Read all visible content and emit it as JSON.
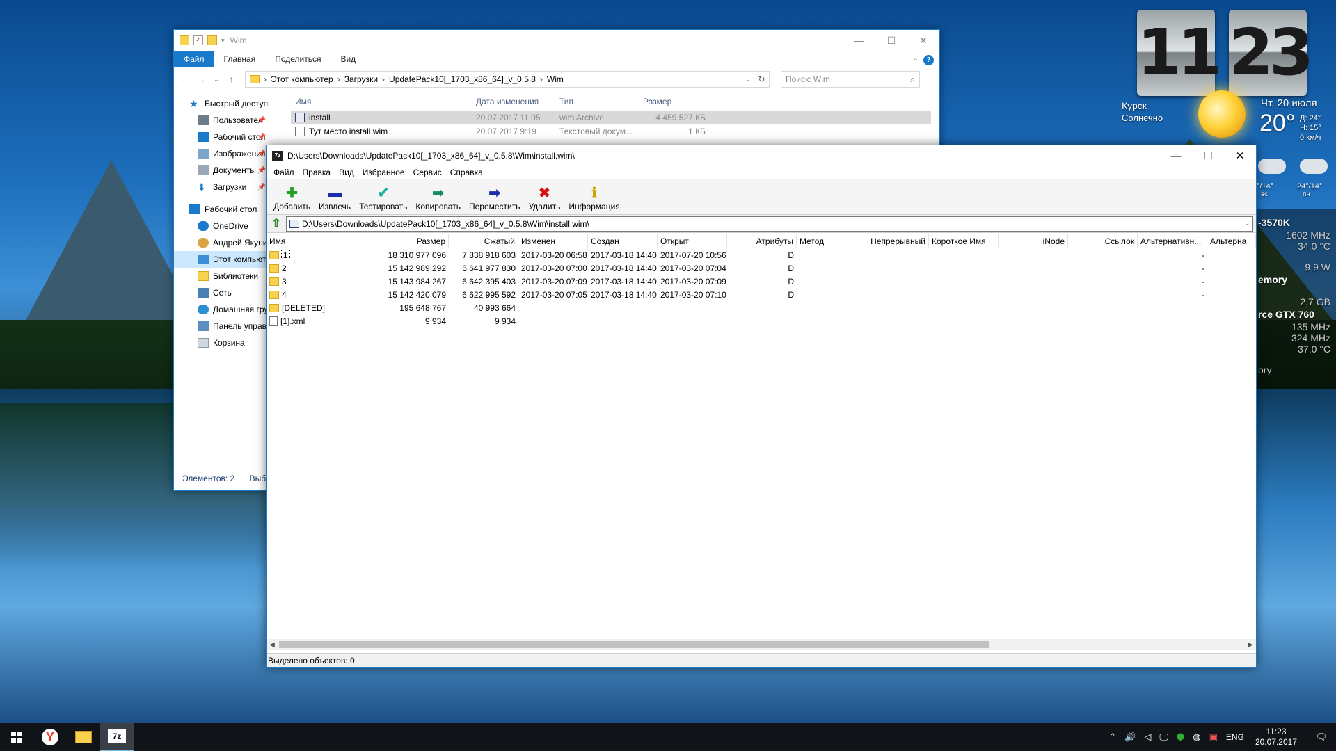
{
  "desktop": {
    "clock_hours": "11",
    "clock_minutes": "23",
    "city": "Курск",
    "condition": "Солнечно",
    "date": "Чт, 20 июля",
    "temperature": "20°",
    "day_high": "Д: 24°",
    "night_low": "Н: 15°",
    "wind": "0 км/ч",
    "forecast": [
      {
        "temp": "°/14°",
        "day": "вс"
      },
      {
        "temp": "24°/14°",
        "day": "пн"
      }
    ],
    "gadget_lines": [
      "-3570K",
      "1602 MHz",
      "34,0 °C",
      "9,9 W",
      "emory",
      "2,7 GB",
      "rce GTX 760",
      "135 MHz",
      "324 MHz",
      "37,0 °C",
      "ory"
    ]
  },
  "explorer": {
    "title": "Wim",
    "ribbon_tabs": [
      "Файл",
      "Главная",
      "Поделиться",
      "Вид"
    ],
    "breadcrumb": [
      "Этот компьютер",
      "Загрузки",
      "UpdatePack10[_1703_x86_64]_v_0.5.8",
      "Wim"
    ],
    "search_placeholder": "Поиск: Wim",
    "nav": [
      {
        "label": "Быстрый доступ",
        "pinned": false
      },
      {
        "label": "Пользовател",
        "pinned": true
      },
      {
        "label": "Рабочий стол",
        "pinned": true
      },
      {
        "label": "Изображения",
        "pinned": true
      },
      {
        "label": "Документы",
        "pinned": true
      },
      {
        "label": "Загрузки",
        "pinned": true
      },
      {
        "label": "Рабочий стол",
        "pinned": false
      },
      {
        "label": "OneDrive",
        "pinned": false
      },
      {
        "label": "Андрей Якуни",
        "pinned": false
      },
      {
        "label": "Этот компьют",
        "pinned": false
      },
      {
        "label": "Библиотеки",
        "pinned": false
      },
      {
        "label": "Сеть",
        "pinned": false
      },
      {
        "label": "Домашняя гру",
        "pinned": false
      },
      {
        "label": "Панель управ",
        "pinned": false
      },
      {
        "label": "Корзина",
        "pinned": false
      }
    ],
    "columns": [
      "Имя",
      "Дата изменения",
      "Тип",
      "Размер"
    ],
    "files": [
      {
        "name": "install",
        "date": "20.07.2017 11:05",
        "type": "wim Archive",
        "size": "4 459 527 КБ"
      },
      {
        "name": "Тут место install.wim",
        "date": "20.07.2017 9:19",
        "type": "Текстовый докум...",
        "size": "1 КБ"
      }
    ],
    "status_items": "Элементов: 2",
    "status_selected": "Выб"
  },
  "sevenzip": {
    "title": "D:\\Users\\Downloads\\UpdatePack10[_1703_x86_64]_v_0.5.8\\Wim\\install.wim\\",
    "menu": [
      "Файл",
      "Правка",
      "Вид",
      "Избранное",
      "Сервис",
      "Справка"
    ],
    "toolbar": [
      {
        "label": "Добавить",
        "icon": "plus-icon",
        "glyph": "✚",
        "color": "#1fa31f"
      },
      {
        "label": "Извлечь",
        "icon": "minus-icon",
        "glyph": "▬",
        "color": "#1b2ea8"
      },
      {
        "label": "Тестировать",
        "icon": "check-icon",
        "glyph": "✔",
        "color": "#1bb0a0"
      },
      {
        "label": "Копировать",
        "icon": "copy-arrow-icon",
        "glyph": "➡",
        "color": "#1b8a6b"
      },
      {
        "label": "Переместить",
        "icon": "move-arrow-icon",
        "glyph": "➡",
        "color": "#1b2ea8"
      },
      {
        "label": "Удалить",
        "icon": "delete-icon",
        "glyph": "✖",
        "color": "#d41414"
      },
      {
        "label": "Информация",
        "icon": "info-icon",
        "glyph": "ℹ",
        "color": "#c9a400"
      }
    ],
    "path": "D:\\Users\\Downloads\\UpdatePack10[_1703_x86_64]_v_0.5.8\\Wim\\install.wim\\",
    "columns": [
      "Имя",
      "Размер",
      "Сжатый",
      "Изменен",
      "Создан",
      "Открыт",
      "Атрибуты",
      "Метод",
      "Непрерывный",
      "Короткое Имя",
      "iNode",
      "Ссылок",
      "Альтернативн...",
      "Альтерна"
    ],
    "rows": [
      {
        "name": "1",
        "type": "folder",
        "size": "18 310 977 096",
        "packed": "7 838 918 603",
        "modified": "2017-03-20 06:58",
        "created": "2017-03-18 14:40",
        "accessed": "2017-07-20 10:56",
        "attr": "D",
        "alt": "-"
      },
      {
        "name": "2",
        "type": "folder",
        "size": "15 142 989 292",
        "packed": "6 641 977 830",
        "modified": "2017-03-20 07:00",
        "created": "2017-03-18 14:40",
        "accessed": "2017-03-20 07:04",
        "attr": "D",
        "alt": "-"
      },
      {
        "name": "3",
        "type": "folder",
        "size": "15 143 984 267",
        "packed": "6 642 395 403",
        "modified": "2017-03-20 07:09",
        "created": "2017-03-18 14:40",
        "accessed": "2017-03-20 07:09",
        "attr": "D",
        "alt": "-"
      },
      {
        "name": "4",
        "type": "folder",
        "size": "15 142 420 079",
        "packed": "6 622 995 592",
        "modified": "2017-03-20 07:05",
        "created": "2017-03-18 14:40",
        "accessed": "2017-03-20 07:10",
        "attr": "D",
        "alt": "-"
      },
      {
        "name": "[DELETED]",
        "type": "folder",
        "size": "195 648 767",
        "packed": "40 993 664",
        "modified": "",
        "created": "",
        "accessed": "",
        "attr": "",
        "alt": ""
      },
      {
        "name": "[1].xml",
        "type": "file",
        "size": "9 934",
        "packed": "9 934",
        "modified": "",
        "created": "",
        "accessed": "",
        "attr": "",
        "alt": ""
      }
    ],
    "status": "Выделено объектов: 0"
  },
  "taskbar": {
    "language": "ENG",
    "time": "11:23",
    "date": "20.07.2017"
  }
}
